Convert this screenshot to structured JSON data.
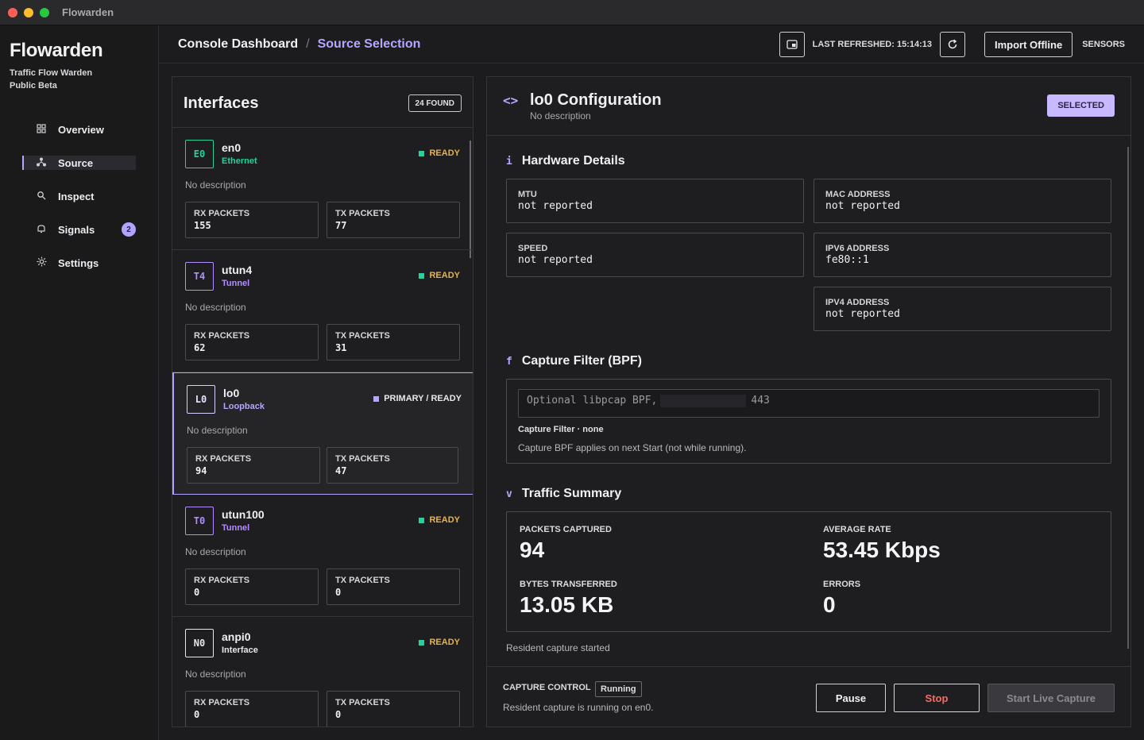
{
  "window": {
    "title": "Flowarden"
  },
  "sidebar": {
    "brand": "Flowarden",
    "subtitle_line1": "Traffic Flow Warden",
    "subtitle_line2": "Public Beta",
    "items": [
      {
        "label": "Overview",
        "icon": "grid-icon"
      },
      {
        "label": "Source",
        "icon": "network-icon",
        "active": true
      },
      {
        "label": "Inspect",
        "icon": "magnifier-icon"
      },
      {
        "label": "Signals",
        "icon": "bell-icon",
        "badge": "2"
      },
      {
        "label": "Settings",
        "icon": "gear-icon"
      }
    ]
  },
  "header": {
    "crumb1": "Console Dashboard",
    "separator": "/",
    "crumb2": "Source Selection",
    "last_refreshed": "LAST REFRESHED: 15:14:13",
    "import_label": "Import Offline",
    "sensors_label": "SENSORS"
  },
  "interfaces": {
    "title": "Interfaces",
    "found": "24 FOUND",
    "rx_label": "RX PACKETS",
    "tx_label": "TX PACKETS",
    "items": [
      {
        "code": "E0",
        "name": "en0",
        "type": "Ethernet",
        "status": "READY",
        "desc": "No description",
        "rx": "155",
        "tx": "77",
        "accent": "#27d19a"
      },
      {
        "code": "T4",
        "name": "utun4",
        "type": "Tunnel",
        "status": "READY",
        "desc": "No description",
        "rx": "62",
        "tx": "31",
        "accent": "#b38cff"
      },
      {
        "code": "L0",
        "name": "lo0",
        "type": "Loopback",
        "status": "PRIMARY / READY",
        "desc": "No description",
        "rx": "94",
        "tx": "47",
        "accent": "#b6a6ff",
        "selected": true
      },
      {
        "code": "T0",
        "name": "utun100",
        "type": "Tunnel",
        "status": "READY",
        "desc": "No description",
        "rx": "0",
        "tx": "0",
        "accent": "#b38cff"
      },
      {
        "code": "N0",
        "name": "anpi0",
        "type": "Interface",
        "status": "READY",
        "desc": "No description",
        "rx": "0",
        "tx": "0",
        "accent": "#e8e8ea"
      }
    ]
  },
  "config": {
    "icon": "<>",
    "title": "lo0 Configuration",
    "desc": "No description",
    "selected_badge": "SELECTED",
    "hardware": {
      "title": "Hardware Details",
      "icon_glyph": "i",
      "mtu_label": "MTU",
      "mtu_value": "not reported",
      "mac_label": "MAC ADDRESS",
      "mac_value": "not reported",
      "speed_label": "SPEED",
      "speed_value": "not reported",
      "ipv6_label": "IPV6 ADDRESS",
      "ipv6_value": "fe80::1",
      "ipv4_label": "IPV4 ADDRESS",
      "ipv4_value": "not reported"
    },
    "filter": {
      "title": "Capture Filter (BPF)",
      "icon_glyph": "f",
      "placeholder_start": "Optional libpcap BPF,",
      "placeholder_end": "443",
      "meta": "Capture Filter · none",
      "note": "Capture BPF applies on next Start (not while running)."
    },
    "traffic": {
      "title": "Traffic Summary",
      "icon_glyph": "v",
      "packets_label": "PACKETS CAPTURED",
      "packets_value": "94",
      "rate_label": "AVERAGE RATE",
      "rate_value": "53.45 Kbps",
      "bytes_label": "BYTES TRANSFERRED",
      "bytes_value": "13.05 KB",
      "errors_label": "ERRORS",
      "errors_value": "0"
    },
    "resident": "Resident capture started",
    "control": {
      "label": "CAPTURE CONTROL",
      "state": "Running",
      "msg": "Resident capture is running on en0.",
      "pause": "Pause",
      "stop": "Stop",
      "start": "Start Live Capture"
    }
  }
}
